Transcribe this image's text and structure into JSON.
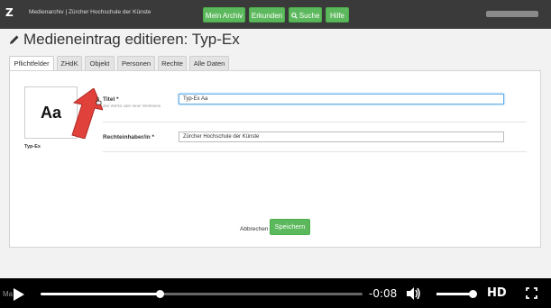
{
  "app": {
    "logo": "Z",
    "title": "Medienarchiv | Zürcher Hochschule der Künste"
  },
  "nav": [
    {
      "label": "Mein Archiv"
    },
    {
      "label": "Erkunden"
    },
    {
      "label": "Suche",
      "icon": "search-icon"
    },
    {
      "label": "Hilfe"
    }
  ],
  "page": {
    "title": "Medieneintrag editieren: Typ-Ex"
  },
  "tabs": [
    {
      "label": "Pflichtfelder",
      "active": true
    },
    {
      "label": "ZHdK"
    },
    {
      "label": "Objekt"
    },
    {
      "label": "Personen"
    },
    {
      "label": "Rechte"
    },
    {
      "label": "Alle Daten"
    }
  ],
  "thumbnail": {
    "glyph": "Aa",
    "caption": "Typ-Ex"
  },
  "fields": [
    {
      "label": "Titel *",
      "hint": "des Werks oder einer Werkserie",
      "value": "Typ-Ex Aa"
    },
    {
      "label": "Rechteinhaber/in *",
      "value": "Zürcher Hochschule der Künste"
    }
  ],
  "actions": {
    "cancel": "Abbrechen",
    "save": "Speichern"
  },
  "player": {
    "time": "-0:08",
    "progress": 0.37,
    "volume": 0.95,
    "quality": "HD",
    "overlay_text": "Ma"
  },
  "colors": {
    "accent_green": "#5cb85c",
    "arrow_red": "#e0413b"
  }
}
